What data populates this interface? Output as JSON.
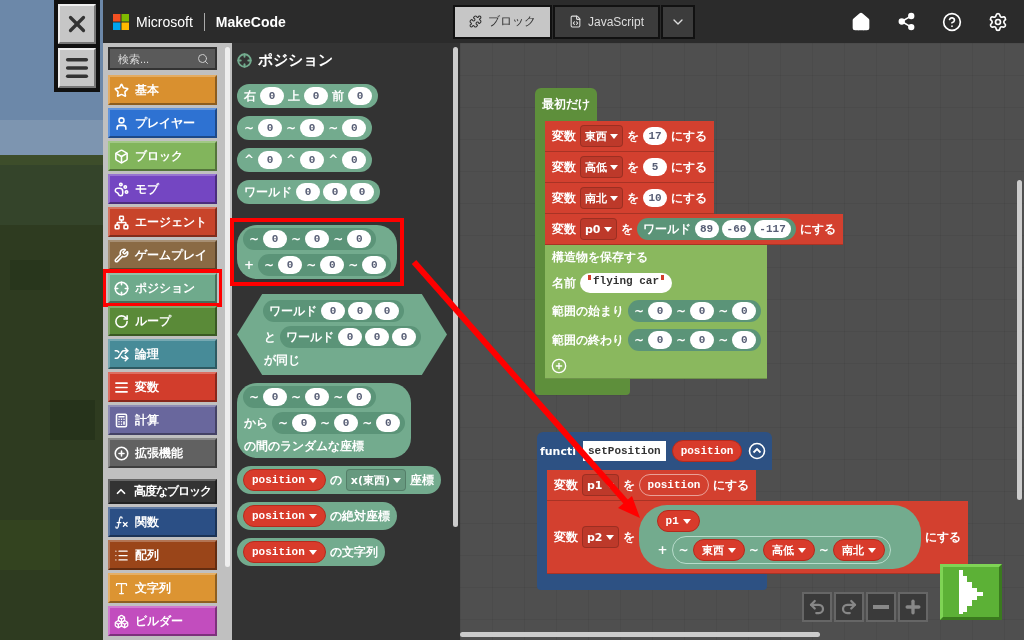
{
  "brand": {
    "company": "Microsoft",
    "product": "MakeCode"
  },
  "editor_tabs": [
    {
      "label": "ブロック",
      "selected": true
    },
    {
      "label": "JavaScript",
      "selected": false
    }
  ],
  "toolbox": {
    "search": {
      "placeholder": "検索..."
    },
    "categories": [
      {
        "label": "基本",
        "color": "#d9902f",
        "highlighted": false
      },
      {
        "label": "プレイヤー",
        "color": "#2e72d2",
        "highlighted": false
      },
      {
        "label": "ブロック",
        "color": "#82b55c",
        "highlighted": false
      },
      {
        "label": "モブ",
        "color": "#7446c2",
        "highlighted": false
      },
      {
        "label": "エージェント",
        "color": "#c8442a",
        "highlighted": false
      },
      {
        "label": "ゲームプレイ",
        "color": "#8a6a44",
        "highlighted": false
      },
      {
        "label": "ポジション",
        "color": "#6faa8c",
        "highlighted": true
      },
      {
        "label": "ループ",
        "color": "#5a8a38",
        "highlighted": false
      },
      {
        "label": "論理",
        "color": "#478b98",
        "highlighted": false
      },
      {
        "label": "変数",
        "color": "#d23d2c",
        "highlighted": false
      },
      {
        "label": "計算",
        "color": "#69679d",
        "highlighted": false
      },
      {
        "label": "拡張機能",
        "color": "#616161",
        "highlighted": false
      }
    ],
    "advanced": {
      "label": "高度なブロック",
      "expanded": true
    },
    "advanced_categories": [
      {
        "label": "関数",
        "color": "#2b4f85",
        "highlighted": false
      },
      {
        "label": "配列",
        "color": "#9a4519",
        "highlighted": false
      },
      {
        "label": "文字列",
        "color": "#dc9432",
        "highlighted": false
      },
      {
        "label": "ビルダー",
        "color": "#c24dbe",
        "highlighted": false
      }
    ]
  },
  "flyout": {
    "title": "ポジション",
    "blocks": [
      {
        "kind": "round",
        "highlighted": false,
        "rows": [
          [
            {
              "kind": "label",
              "text": "右"
            },
            {
              "kind": "num",
              "text": "0"
            },
            {
              "kind": "label",
              "text": "上"
            },
            {
              "kind": "num",
              "text": "0"
            },
            {
              "kind": "label",
              "text": "前"
            },
            {
              "kind": "num",
              "text": "0"
            }
          ]
        ]
      },
      {
        "kind": "round",
        "highlighted": false,
        "rows": [
          [
            {
              "kind": "label",
              "text": "~"
            },
            {
              "kind": "num",
              "text": "0"
            },
            {
              "kind": "label",
              "text": "~"
            },
            {
              "kind": "num",
              "text": "0"
            },
            {
              "kind": "label",
              "text": "~"
            },
            {
              "kind": "num",
              "text": "0"
            }
          ]
        ]
      },
      {
        "kind": "round",
        "highlighted": false,
        "rows": [
          [
            {
              "kind": "label",
              "text": "^"
            },
            {
              "kind": "num",
              "text": "0"
            },
            {
              "kind": "label",
              "text": "^"
            },
            {
              "kind": "num",
              "text": "0"
            },
            {
              "kind": "label",
              "text": "^"
            },
            {
              "kind": "num",
              "text": "0"
            }
          ]
        ]
      },
      {
        "kind": "round",
        "highlighted": false,
        "rows": [
          [
            {
              "kind": "label",
              "text": "ワールド"
            },
            {
              "kind": "num",
              "text": "0"
            },
            {
              "kind": "num",
              "text": "0"
            },
            {
              "kind": "num",
              "text": "0"
            }
          ]
        ]
      },
      {
        "kind": "round",
        "highlighted": true,
        "rows": [
          [
            {
              "kind": "group",
              "items": [
                {
                  "kind": "label",
                  "text": "~"
                },
                {
                  "kind": "num",
                  "text": "0"
                },
                {
                  "kind": "label",
                  "text": "~"
                },
                {
                  "kind": "num",
                  "text": "0"
                },
                {
                  "kind": "label",
                  "text": "~"
                },
                {
                  "kind": "num",
                  "text": "0"
                }
              ]
            }
          ],
          [
            {
              "kind": "label",
              "text": "+"
            },
            {
              "kind": "group",
              "items": [
                {
                  "kind": "label",
                  "text": "~"
                },
                {
                  "kind": "num",
                  "text": "0"
                },
                {
                  "kind": "label",
                  "text": "~"
                },
                {
                  "kind": "num",
                  "text": "0"
                },
                {
                  "kind": "label",
                  "text": "~"
                },
                {
                  "kind": "num",
                  "text": "0"
                }
              ]
            }
          ]
        ]
      },
      {
        "kind": "hex",
        "highlighted": false,
        "rows": [
          [
            {
              "kind": "group",
              "items": [
                {
                  "kind": "label",
                  "text": "ワールド"
                },
                {
                  "kind": "num",
                  "text": "0"
                },
                {
                  "kind": "num",
                  "text": "0"
                },
                {
                  "kind": "num",
                  "text": "0"
                }
              ]
            }
          ],
          [
            {
              "kind": "label",
              "text": "と"
            },
            {
              "kind": "group",
              "items": [
                {
                  "kind": "label",
                  "text": "ワールド"
                },
                {
                  "kind": "num",
                  "text": "0"
                },
                {
                  "kind": "num",
                  "text": "0"
                },
                {
                  "kind": "num",
                  "text": "0"
                }
              ]
            }
          ],
          [
            {
              "kind": "label",
              "text": "が同じ"
            }
          ]
        ]
      },
      {
        "kind": "round",
        "highlighted": false,
        "rows": [
          [
            {
              "kind": "group",
              "items": [
                {
                  "kind": "label",
                  "text": "~"
                },
                {
                  "kind": "num",
                  "text": "0"
                },
                {
                  "kind": "label",
                  "text": "~"
                },
                {
                  "kind": "num",
                  "text": "0"
                },
                {
                  "kind": "label",
                  "text": "~"
                },
                {
                  "kind": "num",
                  "text": "0"
                }
              ]
            }
          ],
          [
            {
              "kind": "label",
              "text": "から"
            },
            {
              "kind": "group",
              "items": [
                {
                  "kind": "label",
                  "text": "~"
                },
                {
                  "kind": "num",
                  "text": "0"
                },
                {
                  "kind": "label",
                  "text": "~"
                },
                {
                  "kind": "num",
                  "text": "0"
                },
                {
                  "kind": "label",
                  "text": "~"
                },
                {
                  "kind": "num",
                  "text": "0"
                }
              ]
            }
          ],
          [
            {
              "kind": "label",
              "text": "の間のランダムな座標"
            }
          ]
        ]
      },
      {
        "kind": "round",
        "highlighted": false,
        "rows": [
          [
            {
              "kind": "var",
              "text": "position"
            },
            {
              "kind": "label",
              "text": "の"
            },
            {
              "kind": "select",
              "text": "x(東西)"
            },
            {
              "kind": "label",
              "text": "座標"
            }
          ]
        ]
      },
      {
        "kind": "round",
        "highlighted": false,
        "rows": [
          [
            {
              "kind": "var",
              "text": "position"
            },
            {
              "kind": "label",
              "text": "の絶対座標"
            }
          ]
        ]
      },
      {
        "kind": "round",
        "highlighted": false,
        "rows": [
          [
            {
              "kind": "var",
              "text": "position"
            },
            {
              "kind": "label",
              "text": "の文字列"
            }
          ]
        ]
      }
    ]
  },
  "workspace": {
    "scripts": [
      {
        "kind": "on_start",
        "header": [
          {
            "kind": "label",
            "text": "最初だけ"
          }
        ],
        "statements": [
          {
            "kind": "set_variable",
            "rows": [
              [
                {
                  "kind": "label",
                  "text": "変数"
                },
                {
                  "kind": "select",
                  "text": "東西"
                },
                {
                  "kind": "label",
                  "text": "を"
                },
                {
                  "kind": "num",
                  "text": "17"
                },
                {
                  "kind": "label",
                  "text": "にする"
                }
              ]
            ]
          },
          {
            "kind": "set_variable",
            "rows": [
              [
                {
                  "kind": "label",
                  "text": "変数"
                },
                {
                  "kind": "select",
                  "text": "高低"
                },
                {
                  "kind": "label",
                  "text": "を"
                },
                {
                  "kind": "num",
                  "text": "5"
                },
                {
                  "kind": "label",
                  "text": "にする"
                }
              ]
            ]
          },
          {
            "kind": "set_variable",
            "rows": [
              [
                {
                  "kind": "label",
                  "text": "変数"
                },
                {
                  "kind": "select",
                  "text": "南北"
                },
                {
                  "kind": "label",
                  "text": "を"
                },
                {
                  "kind": "num",
                  "text": "10"
                },
                {
                  "kind": "label",
                  "text": "にする"
                }
              ]
            ]
          },
          {
            "kind": "set_variable",
            "rows": [
              [
                {
                  "kind": "label",
                  "text": "変数"
                },
                {
                  "kind": "select",
                  "text": "p0"
                },
                {
                  "kind": "label",
                  "text": "を"
                },
                {
                  "kind": "group",
                  "items": [
                    {
                      "kind": "label",
                      "text": "ワールド"
                    },
                    {
                      "kind": "num",
                      "text": "89"
                    },
                    {
                      "kind": "num",
                      "text": "-60"
                    },
                    {
                      "kind": "num",
                      "text": "-117"
                    }
                  ]
                },
                {
                  "kind": "label",
                  "text": "にする"
                }
              ]
            ]
          },
          {
            "kind": "save_structure",
            "rows": [
              [
                {
                  "kind": "label",
                  "text": "構造物を保存する"
                }
              ],
              [
                {
                  "kind": "label",
                  "text": "名前"
                },
                {
                  "kind": "string",
                  "text": "flying car"
                }
              ],
              [
                {
                  "kind": "label",
                  "text": "範囲の始まり"
                },
                {
                  "kind": "group",
                  "items": [
                    {
                      "kind": "label",
                      "text": "~"
                    },
                    {
                      "kind": "num",
                      "text": "0"
                    },
                    {
                      "kind": "label",
                      "text": "~"
                    },
                    {
                      "kind": "num",
                      "text": "0"
                    },
                    {
                      "kind": "label",
                      "text": "~"
                    },
                    {
                      "kind": "num",
                      "text": "0"
                    }
                  ]
                }
              ],
              [
                {
                  "kind": "label",
                  "text": "範囲の終わり"
                },
                {
                  "kind": "group",
                  "items": [
                    {
                      "kind": "label",
                      "text": "~"
                    },
                    {
                      "kind": "num",
                      "text": "0"
                    },
                    {
                      "kind": "label",
                      "text": "~"
                    },
                    {
                      "kind": "num",
                      "text": "0"
                    },
                    {
                      "kind": "label",
                      "text": "~"
                    },
                    {
                      "kind": "num",
                      "text": "0"
                    }
                  ]
                }
              ],
              [
                {
                  "kind": "add_button"
                }
              ]
            ]
          }
        ]
      },
      {
        "kind": "function",
        "header": [
          {
            "kind": "label",
            "text": "functi"
          },
          {
            "kind": "name_field",
            "text": "setPosition"
          },
          {
            "kind": "param",
            "text": "position"
          },
          {
            "kind": "collapse_button"
          }
        ],
        "statements": [
          {
            "kind": "set_variable",
            "rows": [
              [
                {
                  "kind": "label",
                  "text": "変数"
                },
                {
                  "kind": "select",
                  "text": "p1"
                },
                {
                  "kind": "label",
                  "text": "を"
                },
                {
                  "kind": "outline",
                  "text": "position"
                },
                {
                  "kind": "label",
                  "text": "にする"
                }
              ]
            ]
          },
          {
            "kind": "set_variable",
            "rows": [
              [
                {
                  "kind": "label",
                  "text": "変数"
                },
                {
                  "kind": "select",
                  "text": "p2"
                },
                {
                  "kind": "label",
                  "text": "を"
                },
                {
                  "kind": "reporter",
                  "rows": [
                    [
                      {
                        "kind": "var",
                        "text": "p1"
                      }
                    ],
                    [
                      {
                        "kind": "label",
                        "text": "+"
                      },
                      {
                        "kind": "ring",
                        "items": [
                          {
                            "kind": "label",
                            "text": "~"
                          },
                          {
                            "kind": "var",
                            "text": "東西"
                          },
                          {
                            "kind": "label",
                            "text": "~"
                          },
                          {
                            "kind": "var",
                            "text": "高低"
                          },
                          {
                            "kind": "label",
                            "text": "~"
                          },
                          {
                            "kind": "var",
                            "text": "南北"
                          }
                        ]
                      }
                    ]
                  ]
                },
                {
                  "kind": "label",
                  "text": "にする"
                }
              ]
            ]
          }
        ]
      }
    ]
  }
}
